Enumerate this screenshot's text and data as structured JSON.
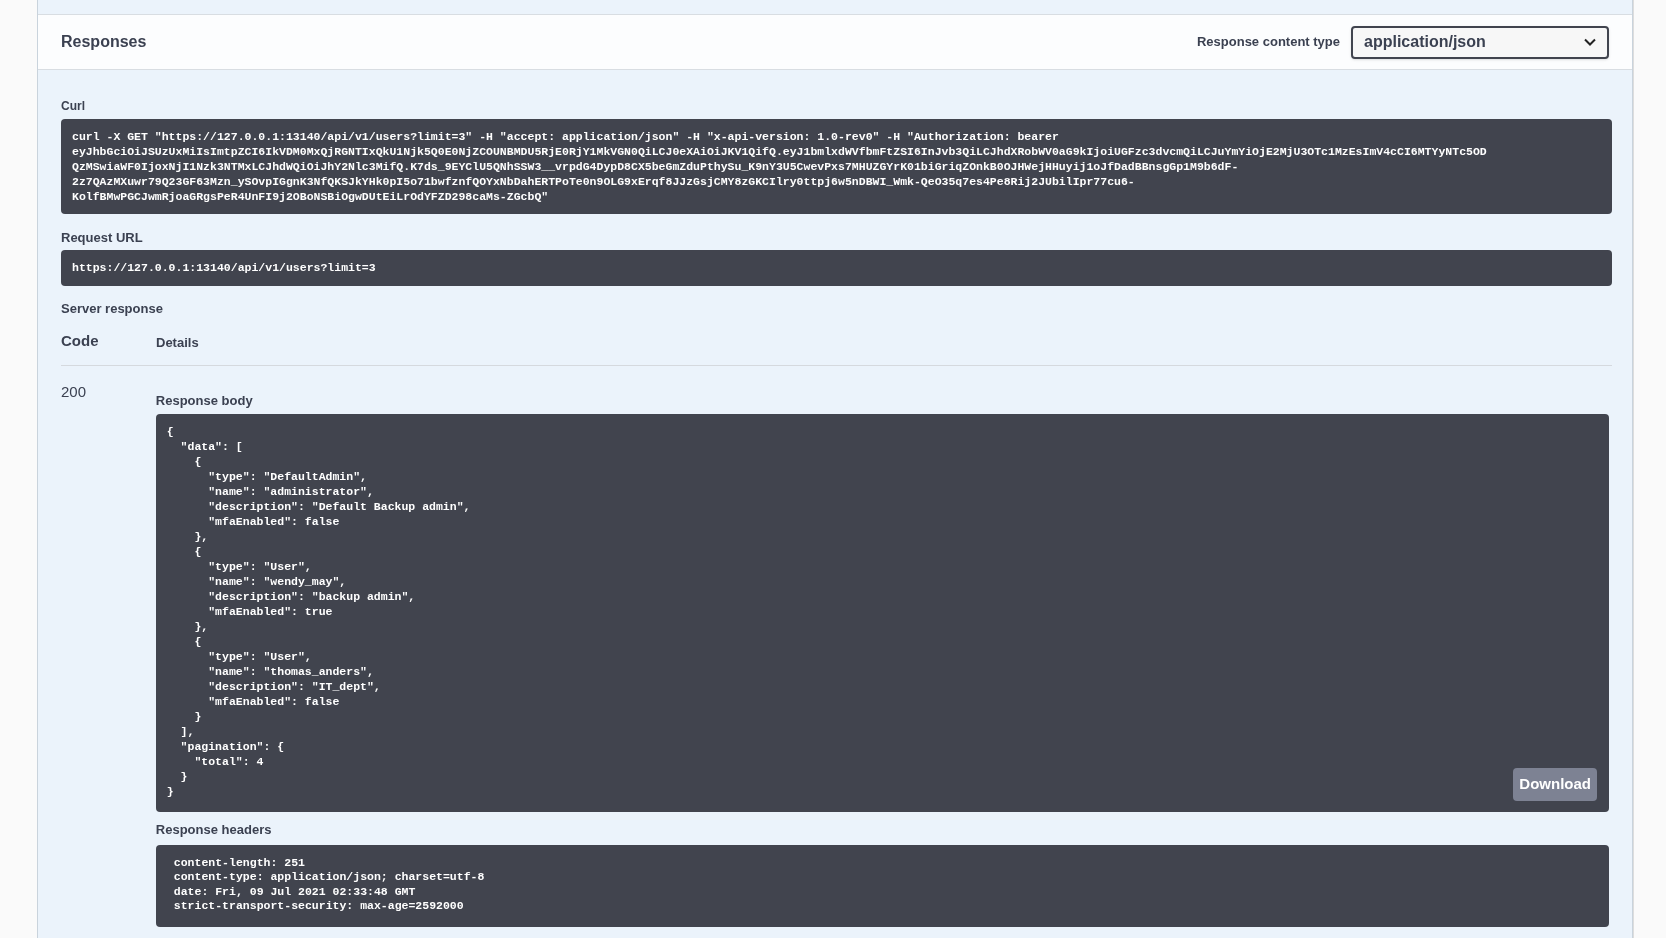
{
  "header": {
    "title": "Responses",
    "content_type_label": "Response content type",
    "content_type_value": "application/json"
  },
  "curl": {
    "label": "Curl",
    "lines": [
      "curl -X GET \"https://127.0.0.1:13140/api/v1/users?limit=3\" -H \"accept: application/json\" -H \"x-api-version: 1.0-rev0\" -H \"Authorization: bearer",
      "eyJhbGciOiJSUzUxMiIsImtpZCI6IkVDM0MxQjRGNTIxQkU1Njk5Q0E0NjZCOUNBMDU5RjE0RjY1MkVGN0QiLCJ0eXAiOiJKV1QifQ.eyJ1bmlxdWVfbmFtZSI6InJvb3QiLCJhdXRobWV0aG9kIjoiUGFzc3dvcmQiLCJuYmYiOjE2MjU3OTc1MzEsImV4cCI6MTYyNTc5OD",
      "QzMSwiaWF0IjoxNjI1Nzk3NTMxLCJhdWQiOiJhY2Nlc3MifQ.K7ds_9EYClU5QNhSSW3__vrpdG4DypD8CX5beGmZduPthySu_K9nY3U5CwevPxs7MHUZGYrK01biGriqZOnkB0OJHWejHHuyij1oJfDadBBnsgGp1M9b6dF-",
      "2z7QAzMXuwr79Q23GF63Mzn_ySOvpIGgnK3NfQKSJkYHk0pI5o71bwfznfQOYxNbDahERTPoTe0n9OLG9xErqf8JJzGsjCMY8zGKCIlry0ttpj6w5nDBWI_Wmk-QeO35q7es4Pe8Rij2JUbilIpr77cu6-",
      "KolfBMwPGCJwmRjoaGRgsPeR4UnFI9j2OBoNSBiOgwDUtEiLrOdYFZD298caMs-ZGcbQ\""
    ]
  },
  "request_url": {
    "label": "Request URL",
    "value": "https://127.0.0.1:13140/api/v1/users?limit=3"
  },
  "server_response": {
    "label": "Server response",
    "columns": [
      "Code",
      "Details"
    ],
    "code": "200",
    "body_label": "Response body",
    "body_lines": [
      "{",
      "  \"data\": [",
      "    {",
      "      \"type\": \"DefaultAdmin\",",
      "      \"name\": \"administrator\",",
      "      \"description\": \"Default Backup admin\",",
      "      \"mfaEnabled\": false",
      "    },",
      "    {",
      "      \"type\": \"User\",",
      "      \"name\": \"wendy_may\",",
      "      \"description\": \"backup admin\",",
      "      \"mfaEnabled\": true",
      "    },",
      "    {",
      "      \"type\": \"User\",",
      "      \"name\": \"thomas_anders\",",
      "      \"description\": \"IT_dept\",",
      "      \"mfaEnabled\": false",
      "    }",
      "  ],",
      "  \"pagination\": {",
      "    \"total\": 4",
      "  }",
      "}"
    ],
    "download_button": "Download",
    "headers_label": "Response headers",
    "headers_lines": [
      "content-length: 251",
      "content-type: application/json; charset=utf-8",
      "date: Fri, 09 Jul 2021 02:33:48 GMT",
      "strict-transport-security: max-age=2592000"
    ]
  }
}
